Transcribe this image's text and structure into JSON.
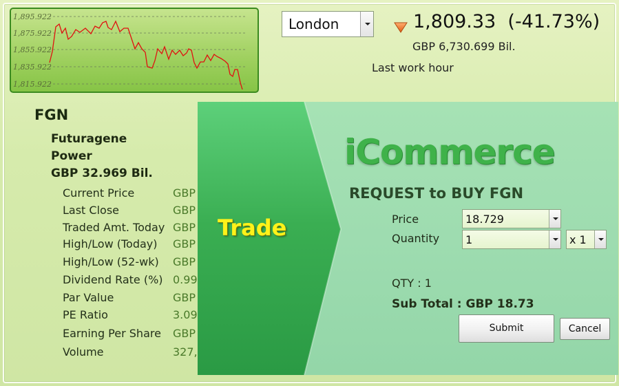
{
  "mini_chart": {
    "y_ticks": [
      "1,895.922",
      "1,875.922",
      "1,855.922",
      "1,835.922",
      "1,815.922"
    ],
    "line_color": "#e01010",
    "background_color": "#9fd05f"
  },
  "market": {
    "selected": "London",
    "trend_icon": "down-triangle-icon",
    "index_value": "1,809.33",
    "index_change": "(-41.73%)",
    "volume": "GBP 6,730.699 Bil.",
    "period_label": "Last work hour"
  },
  "stock": {
    "ticker": "FGN",
    "company_line1": "Futuragene",
    "company_line2": "Power",
    "market_cap": "GBP 32.969 Bil.",
    "stats": [
      {
        "label": "Current Price",
        "value": "GBP"
      },
      {
        "label": "Last Close",
        "value": "GBP"
      },
      {
        "label": "Traded Amt. Today",
        "value": "GBP"
      },
      {
        "label": "High/Low (Today)",
        "value": "GBP"
      },
      {
        "label": "High/Low (52-wk)",
        "value": "GBP"
      },
      {
        "label": "Dividend Rate (%)",
        "value": "0.99"
      },
      {
        "label": "Par Value",
        "value": "GBP"
      },
      {
        "label": "PE Ratio",
        "value": "3.09"
      },
      {
        "label": "Earning Per Share",
        "value": "GBP"
      },
      {
        "label": "Volume",
        "value": "327,"
      }
    ]
  },
  "trade": {
    "arrow_label": "Trade",
    "brand": "iCommerce",
    "request_title": "REQUEST to BUY FGN",
    "price_label": "Price",
    "price_value": "18.729",
    "quantity_label": "Quantity",
    "quantity_value": "1",
    "multiplier_value": "x 1",
    "qty_summary": "QTY : 1",
    "subtotal": "Sub Total : GBP 18.73",
    "submit_label": "Submit",
    "cancel_label": "Cancel",
    "brand_color": "#3fb24a",
    "trade_label_color": "#fff21a"
  }
}
